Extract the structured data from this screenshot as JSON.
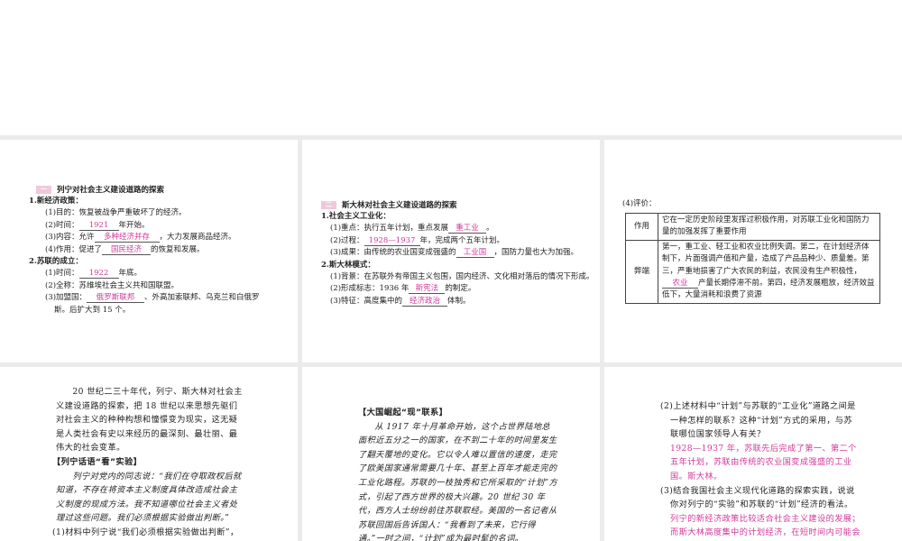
{
  "p1": {
    "badge": "一",
    "title": "列宁对社会主义建设道路的探索",
    "s1": "1.新经济政策：",
    "l1": "(1)目的：恢复被战争严重破坏了的经济。",
    "l2a": "(2)时间：",
    "l2ans": "1921",
    "l2b": "年开始。",
    "l3a": "(3)内容：允许",
    "l3ans": "多种经济并存",
    "l3b": "，大力发展商品经济。",
    "l4a": "(4)作用：促进了",
    "l4ans": "国民经济",
    "l4b": "的恢复和发展。",
    "s2": "2.苏联的成立：",
    "m1a": "(1)时间：",
    "m1ans": "1922",
    "m1b": "年底。",
    "m2": "(2)全称：苏维埃社会主义共和国联盟。",
    "m3a": "(3)加盟国：",
    "m3ans": "俄罗斯联邦",
    "m3b": "、外高加索联邦、乌克兰和白俄罗",
    "m3c": "斯。后扩大到 15 个。"
  },
  "p2": {
    "badge": "二",
    "title": "斯大林对社会主义建设道路的探索",
    "s1": "1.社会主义工业化：",
    "l1a": "(1)重点：执行五年计划，重点发展",
    "l1ans": "重工业",
    "l1b": "。",
    "l2a": "(2)过程：",
    "l2ans": "1928—1937",
    "l2b": "年，完成两个五年计划。",
    "l3a": "(3)成果：由传统的农业国变成强盛的",
    "l3ans": "工业国",
    "l3b": "，国防力量也大为加强。",
    "s2": "2.斯大林模式：",
    "m1": "(1)背景：在苏联外有帝国主义包围，国内经济、文化相对落后的情况下形成。",
    "m2a": "(2)形成标志：1936 年",
    "m2ans": "新宪法",
    "m2b": "的制定。",
    "m3a": "(3)特征：高度集中的",
    "m3ans": "经济政治",
    "m3b": "体制。"
  },
  "p3": {
    "label": "(4)评价：",
    "r1k": "作用",
    "r1v": "它在一定历史阶段里发挥过积极作用，对苏联工业化和国防力量的加强发挥了重要作用",
    "r2k": "弊端",
    "r2a": "第一，重工业、轻工业和农业比例失调。第二，在计划经济体制下，片面强调产值和产量，造成了产品品种少、质量差。第三，严重地损害了广大农民的利益，农民没有生产积极性，",
    "r2ans": "农业",
    "r2b": "产量长期停滞不前。第四，经济发展粗放，经济效益低下，大量消耗和浪费了资源"
  },
  "p4": {
    "intro": "20 世纪二三十年代，列宁、斯大林对社会主义建设道路的探索，把 18 世纪以来思想先驱们对社会主义的种种构想和憧憬变为现实，这无疑是人类社会有史以来经历的最深刻、最壮丽、最伟大的社会变革。",
    "head": "【列宁话语“看”实验】",
    "quote": "列宁对党内的同志说：“我们在夺取政权后就知道，不存在将资本主义制度具体改造成社会主义制度的现成方法。我不知道哪位社会主义者处理过这些问题。我们必须根据实验做出判断。”",
    "q1": "(1)材料中列宁说“我们必须根据实验做出判断”，列宁进行了怎样的实验来发展社会主义？取得了怎样的成效？"
  },
  "p5": {
    "head": "【大国崛起“现”联系】",
    "text": "从 1917 年十月革命开始，这个占世界陆地总面积近五分之一的国家，在不到二十年的时间里发生了翻天覆地的变化。它以令人难以置信的速度，走完了欧美国家通常需要几十年、甚至上百年才能走完的工业化路程。苏联的一枝独秀和它所采取的“计划”方式，引起了西方世界的极大兴趣。20 世纪 30 年代，西方人士纷纷前往苏联取经。美国的一名记者从苏联回国后告诉国人：“我看到了未来，它行得通。”一时之间，“计划”成为最时髦的名词。"
  },
  "p6": {
    "q2": "(2)上述材料中“计划”与苏联的“工业化”道路之间是一种怎样的联系？这种“计划”方式的采用，与苏联哪位国家领导人有关？",
    "a2": "1928—1937 年，苏联先后完成了第一、第二个五年计划，苏联由传统的农业国变成强盛的工业国。斯大林。",
    "q3": "(3)结合我国社会主义现代化道路的探索实践，说说你对列宁的“实验”和苏联的“计划”经济的看法。",
    "a3": "列宁的新经济政策比较适合社会主义建设的发展；而斯大林高度集中的计划经济，在短时间内可能会促进经济的发展，但从长远来看，其弊端很"
  },
  "colors": {
    "answer": "#d2399a",
    "badge": "#f2c6dc",
    "gap": "#ebebeb"
  }
}
